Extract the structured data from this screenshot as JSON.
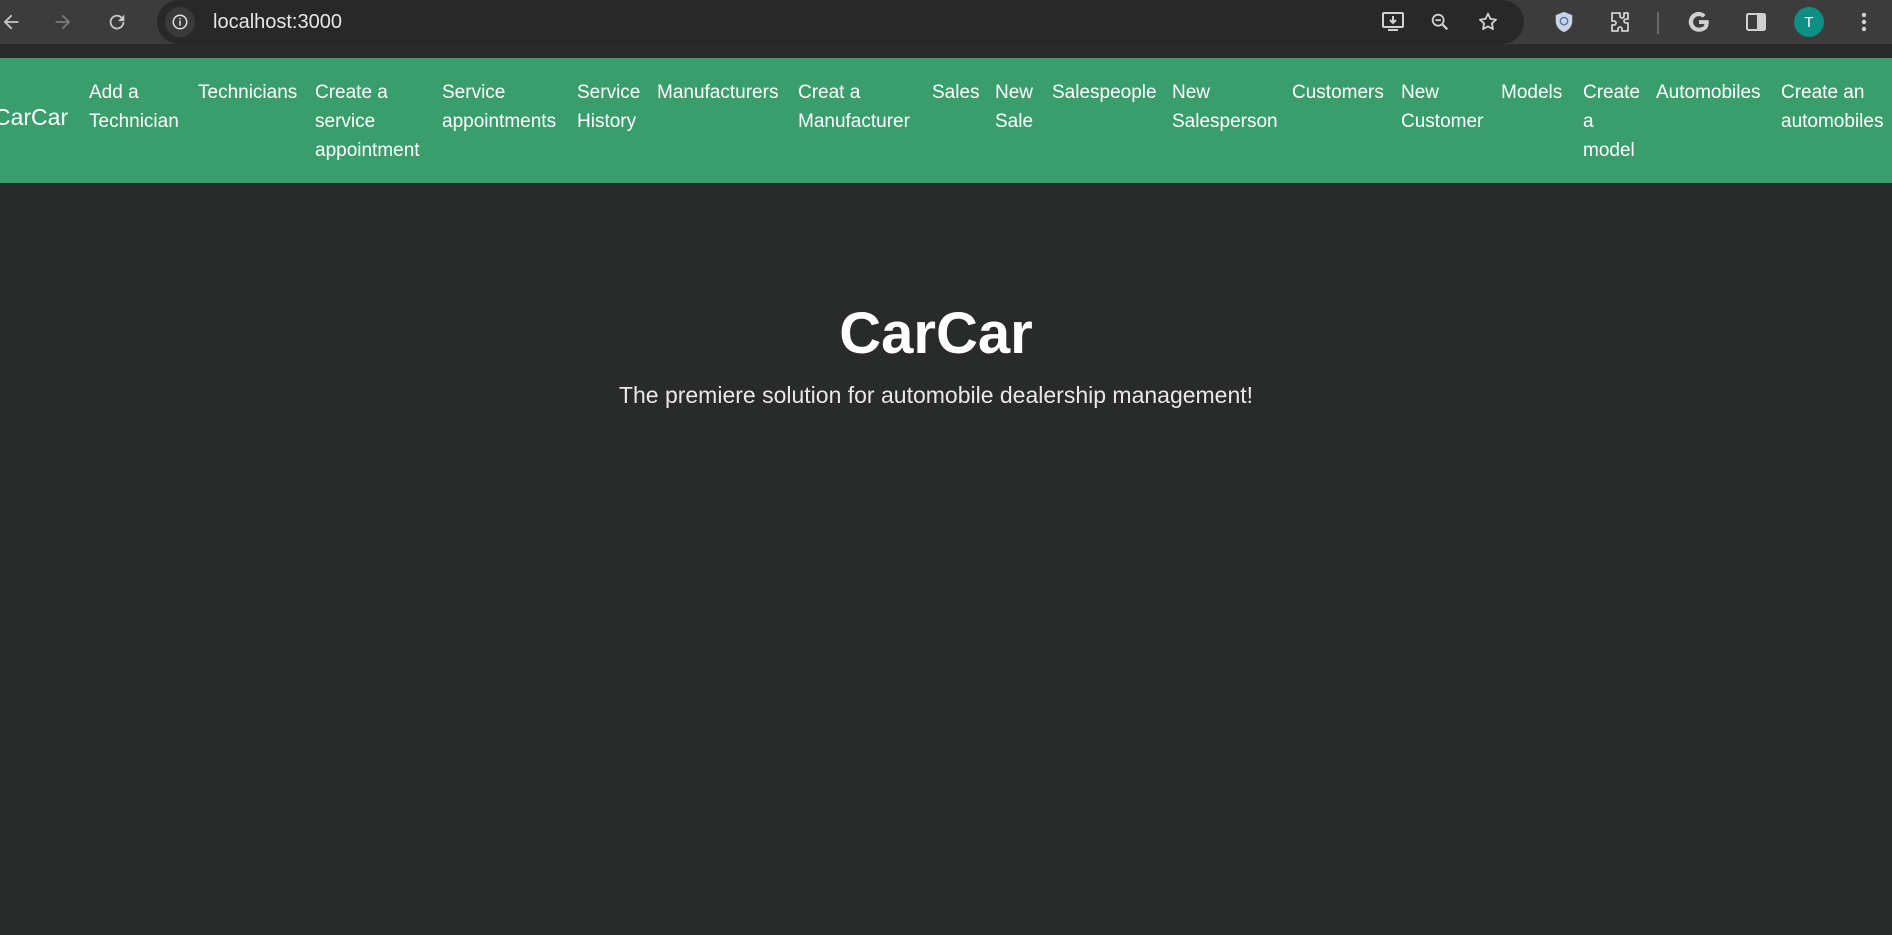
{
  "browser": {
    "url": "localhost:3000",
    "avatar_initial": "T",
    "icons": [
      "back-arrow-icon",
      "forward-arrow-icon",
      "reload-icon",
      "site-info-icon",
      "install-app-icon",
      "zoom-icon",
      "bookmark-star-icon",
      "shield-icon",
      "extensions-puzzle-icon",
      "google-icon",
      "side-panel-icon",
      "more-menu-icon"
    ]
  },
  "navbar": {
    "brand": "CarCar",
    "color": "#3a9d6c",
    "links": [
      {
        "label": "Add a Technician"
      },
      {
        "label": "Technicians"
      },
      {
        "label": "Create a service appointment"
      },
      {
        "label": "Service appointments"
      },
      {
        "label": "Service History"
      },
      {
        "label": "Manufacturers"
      },
      {
        "label": "Creat a Manufacturer"
      },
      {
        "label": "Sales"
      },
      {
        "label": "New Sale"
      },
      {
        "label": "Salespeople"
      },
      {
        "label": "New Salesperson"
      },
      {
        "label": "Customers"
      },
      {
        "label": "New Customer"
      },
      {
        "label": "Models"
      },
      {
        "label": "Create a model"
      },
      {
        "label": "Automobiles"
      },
      {
        "label": "Create an automobiles"
      }
    ]
  },
  "hero": {
    "title": "CarCar",
    "subtitle": "The premiere solution for automobile dealership management!"
  },
  "colors": {
    "page_background": "#292a2a",
    "navbar": "#3a9d6c",
    "browser_chrome": "#3c3c3c",
    "avatar": "#0d8f83"
  }
}
